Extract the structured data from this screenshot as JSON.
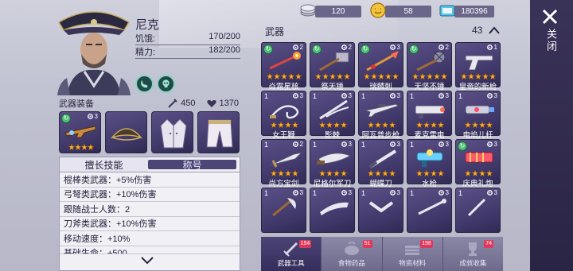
{
  "character": {
    "name": "尼克",
    "hunger_label": "饥饿:",
    "hunger_value": "170/200",
    "energy_label": "精力:",
    "energy_value": "182/200"
  },
  "equipment": {
    "title": "武器装备",
    "attack": "450",
    "defense": "1370",
    "slots": [
      {
        "level": "3",
        "stars": 4,
        "recycle": true,
        "icon": "rifle-icon"
      },
      {
        "level": "",
        "stars": 0,
        "recycle": false,
        "icon": "pirate-hat-icon"
      },
      {
        "level": "",
        "stars": 0,
        "recycle": false,
        "icon": "coat-icon"
      },
      {
        "level": "",
        "stars": 0,
        "recycle": false,
        "icon": "pants-icon"
      }
    ]
  },
  "skills": {
    "tab_active": "擅长技能",
    "tab_inactive": "称号",
    "lines": [
      "棍棒类武器：+5%伤害",
      "弓弩类武器：+10%伤害",
      "跟随战士人数：2",
      "刀斧类武器：+10%伤害",
      "移动速度：+10%",
      "基础生命：+500"
    ]
  },
  "currency": {
    "silver": "120",
    "gold": "58",
    "tickets": "180396"
  },
  "weapons": {
    "title": "武器",
    "count": "43",
    "items": [
      {
        "name": "焱霜星核",
        "count": "",
        "level": "2",
        "stars": 5,
        "recycle": true,
        "icon": "orb-staff-icon"
      },
      {
        "name": "祭天锤",
        "count": "",
        "level": "2",
        "stars": 5,
        "recycle": true,
        "icon": "hammer-icon"
      },
      {
        "name": "瑞麟刺",
        "count": "",
        "level": "3",
        "stars": 5,
        "recycle": true,
        "icon": "spear-icon"
      },
      {
        "name": "无坚不锤",
        "count": "",
        "level": "2",
        "stars": 5,
        "recycle": true,
        "icon": "spiked-hammer-icon"
      },
      {
        "name": "皇帝的新枪",
        "count": "",
        "level": "1",
        "stars": 5,
        "recycle": false,
        "icon": "pistol-icon"
      },
      {
        "name": "女王鞭",
        "count": "1",
        "level": "3",
        "stars": 4,
        "recycle": false,
        "icon": "whip-icon"
      },
      {
        "name": "影棘",
        "count": "1",
        "level": "3",
        "stars": 4,
        "recycle": false,
        "icon": "claw-icon"
      },
      {
        "name": "阿瓦普步枪",
        "count": "1",
        "level": "3",
        "stars": 4,
        "recycle": false,
        "icon": "rifle-icon"
      },
      {
        "name": "麦克雷电",
        "count": "1",
        "level": "3",
        "stars": 4,
        "recycle": false,
        "icon": "cannon-icon"
      },
      {
        "name": "电焰儿杆",
        "count": "1",
        "level": "3",
        "stars": 4,
        "recycle": false,
        "icon": "blaster-icon"
      },
      {
        "name": "尚方宝剑",
        "count": "1",
        "level": "2",
        "stars": 4,
        "recycle": false,
        "icon": "sword-icon"
      },
      {
        "name": "尼格尔军刀",
        "count": "1",
        "level": "3",
        "stars": 4,
        "recycle": false,
        "icon": "machete-icon"
      },
      {
        "name": "蝴蝶刀",
        "count": "1",
        "level": "3",
        "stars": 4,
        "recycle": false,
        "icon": "knife-icon"
      },
      {
        "name": "水枪",
        "count": "1",
        "level": "3",
        "stars": 4,
        "recycle": false,
        "icon": "water-gun-icon"
      },
      {
        "name": "庆典礼炮",
        "count": "1",
        "level": "3",
        "stars": 4,
        "recycle": true,
        "icon": "firework-icon"
      },
      {
        "name": "",
        "count": "1",
        "level": "3",
        "stars": 0,
        "recycle": false,
        "icon": "axe-icon"
      },
      {
        "name": "",
        "count": "1",
        "level": "3",
        "stars": 0,
        "recycle": false,
        "icon": "blade-icon"
      },
      {
        "name": "",
        "count": "1",
        "level": "3",
        "stars": 0,
        "recycle": false,
        "icon": "chevron-blade-icon"
      },
      {
        "name": "",
        "count": "1",
        "level": "3",
        "stars": 0,
        "recycle": false,
        "icon": "rod-icon"
      },
      {
        "name": "",
        "count": "1",
        "level": "3",
        "stars": 0,
        "recycle": false,
        "icon": "staff-icon"
      }
    ]
  },
  "bottom_tabs": [
    {
      "label": "武器工具",
      "badge": "154",
      "active": true,
      "icon": "sword-icon"
    },
    {
      "label": "食物药品",
      "badge": "51",
      "active": false,
      "icon": "food-icon"
    },
    {
      "label": "物资材料",
      "badge": "198",
      "active": false,
      "icon": "materials-icon"
    },
    {
      "label": "成就收集",
      "badge": "74",
      "active": false,
      "icon": "trophy-icon"
    }
  ],
  "close": {
    "label": "关闭"
  },
  "colors": {
    "panel_purple": "#40386a",
    "star_yellow": "#f7b12a",
    "badge_red": "#e0385c",
    "close_bar": "#2a2445"
  }
}
